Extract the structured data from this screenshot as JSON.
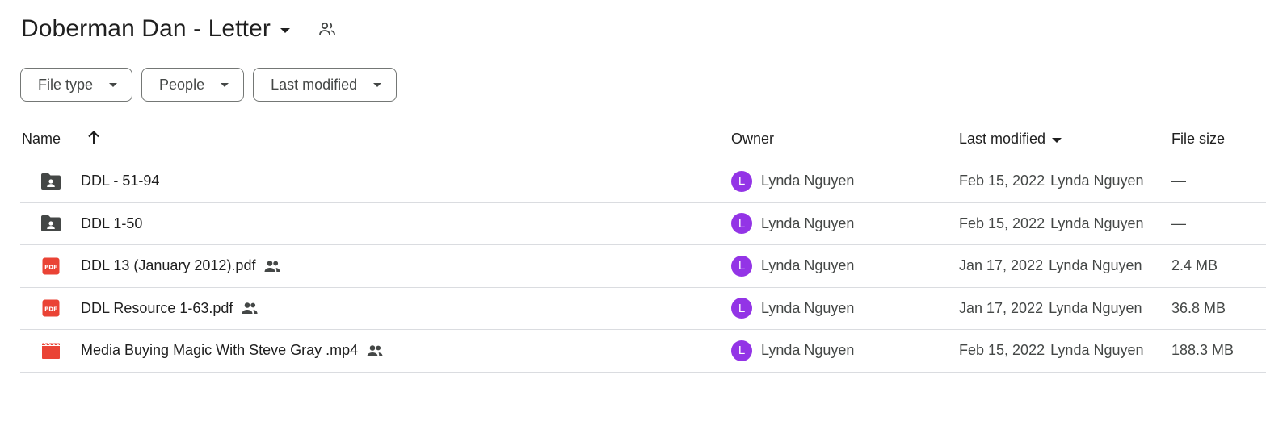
{
  "header": {
    "title": "Doberman Dan - Letter",
    "title_icon": "caret-down-icon",
    "shared_icon": "people-outline-icon"
  },
  "filters": [
    {
      "label": "File type"
    },
    {
      "label": "People"
    },
    {
      "label": "Last modified"
    }
  ],
  "columns": {
    "name": "Name",
    "owner": "Owner",
    "last_modified": "Last modified",
    "file_size": "File size",
    "sort_icon": "arrow-up-icon"
  },
  "colors": {
    "folder_icon": "#444746",
    "pdf_icon": "#ea4335",
    "video_icon": "#ea4335",
    "avatar": "#9334e6",
    "divider": "#dadce0"
  },
  "rows": [
    {
      "type": "folder",
      "icon": "shared-folder-icon",
      "name": "DDL - 51-94",
      "shared": false,
      "owner": "Lynda Nguyen",
      "avatar_letter": "L",
      "modified_date": "Feb 15, 2022",
      "modified_by": "Lynda Nguyen",
      "size": "—"
    },
    {
      "type": "folder",
      "icon": "shared-folder-icon",
      "name": "DDL 1-50",
      "shared": false,
      "owner": "Lynda Nguyen",
      "avatar_letter": "L",
      "modified_date": "Feb 15, 2022",
      "modified_by": "Lynda Nguyen",
      "size": "—"
    },
    {
      "type": "pdf",
      "icon": "pdf-icon",
      "name": "DDL 13 (January 2012).pdf",
      "shared": true,
      "owner": "Lynda Nguyen",
      "avatar_letter": "L",
      "modified_date": "Jan 17, 2022",
      "modified_by": "Lynda Nguyen",
      "size": "2.4 MB"
    },
    {
      "type": "pdf",
      "icon": "pdf-icon",
      "name": "DDL Resource 1-63.pdf",
      "shared": true,
      "owner": "Lynda Nguyen",
      "avatar_letter": "L",
      "modified_date": "Jan 17, 2022",
      "modified_by": "Lynda Nguyen",
      "size": "36.8 MB"
    },
    {
      "type": "video",
      "icon": "video-icon",
      "name": "Media Buying Magic With Steve Gray .mp4",
      "shared": true,
      "owner": "Lynda Nguyen",
      "avatar_letter": "L",
      "modified_date": "Feb 15, 2022",
      "modified_by": "Lynda Nguyen",
      "size": "188.3 MB"
    }
  ]
}
